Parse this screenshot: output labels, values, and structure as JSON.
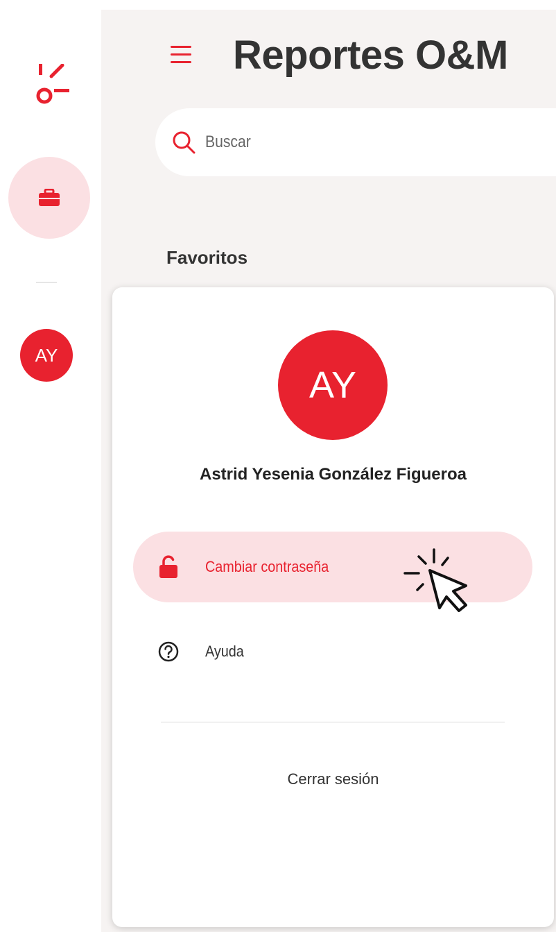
{
  "header": {
    "title": "Reportes O&M"
  },
  "search": {
    "placeholder": "Buscar"
  },
  "sections": {
    "favorites_label": "Favoritos"
  },
  "rail": {
    "avatar_initials": "AY"
  },
  "profile_menu": {
    "avatar_initials": "AY",
    "user_name": "Astrid Yesenia González Figueroa",
    "items": [
      {
        "label": "Cambiar contraseña",
        "icon": "unlock-icon",
        "active": true
      },
      {
        "label": "Ayuda",
        "icon": "help-icon",
        "active": false
      }
    ],
    "logout_label": "Cerrar sesión"
  },
  "colors": {
    "accent": "#e8222f",
    "active_bg": "#fbe0e3",
    "main_bg": "#f6f3f2"
  }
}
